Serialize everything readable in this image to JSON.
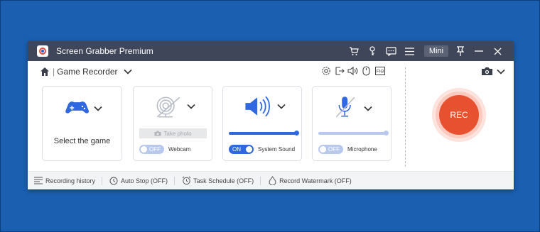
{
  "app": {
    "title": "Screen Grabber Premium",
    "mini_label": "Mini",
    "mode_label": "Game Recorder",
    "mode_separator": "|"
  },
  "titlebar_icons": [
    "cart-icon",
    "key-icon",
    "chat-icon",
    "menu-icon",
    "pin-icon",
    "minimize-icon",
    "close-icon"
  ],
  "toolbar_icons": [
    "settings-icon",
    "export-icon",
    "volume-icon",
    "mouse-icon",
    "fps-icon"
  ],
  "cards": {
    "game": {
      "label": "Select the game"
    },
    "webcam": {
      "take_photo": "Take photo",
      "toggle": "OFF",
      "label": "Webcam"
    },
    "sound": {
      "toggle": "ON",
      "label": "System Sound",
      "volume": 1.0
    },
    "mic": {
      "toggle": "OFF",
      "label": "Microphone",
      "volume": 1.0
    }
  },
  "rec": {
    "label": "REC"
  },
  "footer": {
    "items": [
      {
        "label": "Recording history"
      },
      {
        "label": "Auto Stop (OFF)"
      },
      {
        "label": "Task Schedule (OFF)"
      },
      {
        "label": "Record Watermark (OFF)"
      }
    ]
  },
  "colors": {
    "accent": "#2f68e0",
    "rec": "#e8512f",
    "titlebar": "#3f4659",
    "desktop": "#1a5fb0"
  }
}
